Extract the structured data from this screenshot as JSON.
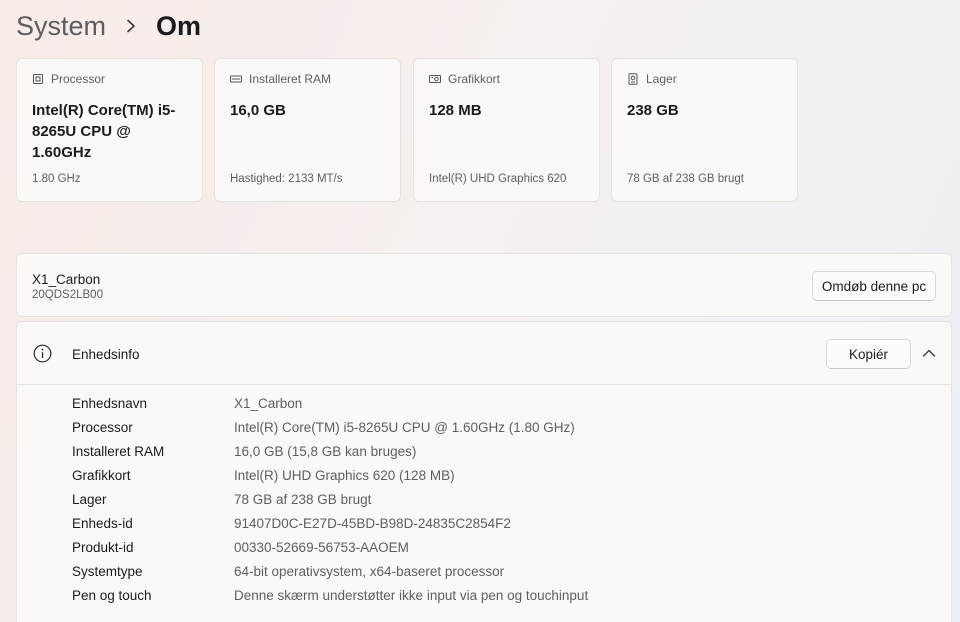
{
  "breadcrumb": {
    "parent": "System",
    "separator_icon": "chevron-right-icon",
    "current": "Om"
  },
  "cards": [
    {
      "icon": "processor-icon",
      "label": "Processor",
      "value": "Intel(R) Core(TM) i5-8265U CPU @ 1.60GHz",
      "sub": "1.80 GHz"
    },
    {
      "icon": "memory-icon",
      "label": "Installeret RAM",
      "value": "16,0 GB",
      "sub": "Hastighed: 2133 MT/s"
    },
    {
      "icon": "graphics-card-icon",
      "label": "Grafikkort",
      "value": "128 MB",
      "sub": "Intel(R) UHD Graphics 620"
    },
    {
      "icon": "storage-icon",
      "label": "Lager",
      "value": "238 GB",
      "sub": "78 GB af 238 GB brugt"
    }
  ],
  "device": {
    "name": "X1_Carbon",
    "model": "20QDS2LB00",
    "rename_label": "Omdøb denne pc"
  },
  "device_info": {
    "title": "Enhedsinfo",
    "icon": "info-icon",
    "copy_label": "Kopiér",
    "collapse_icon": "chevron-up-icon",
    "rows": [
      {
        "key": "Enhedsnavn",
        "value": "X1_Carbon"
      },
      {
        "key": "Processor",
        "value": "Intel(R) Core(TM) i5-8265U CPU @ 1.60GHz (1.80 GHz)"
      },
      {
        "key": "Installeret RAM",
        "value": "16,0 GB (15,8 GB kan bruges)"
      },
      {
        "key": "Grafikkort",
        "value": "Intel(R) UHD Graphics 620 (128 MB)"
      },
      {
        "key": "Lager",
        "value": "78 GB af 238 GB brugt"
      },
      {
        "key": "Enheds-id",
        "value": "91407D0C-E27D-45BD-B98D-24835C2854F2"
      },
      {
        "key": "Produkt-id",
        "value": "00330-52669-56753-AAOEM"
      },
      {
        "key": "Systemtype",
        "value": "64-bit operativsystem, x64-baseret processor"
      },
      {
        "key": "Pen og touch",
        "value": "Denne skærm understøtter ikke input via pen og touchinput"
      }
    ]
  }
}
